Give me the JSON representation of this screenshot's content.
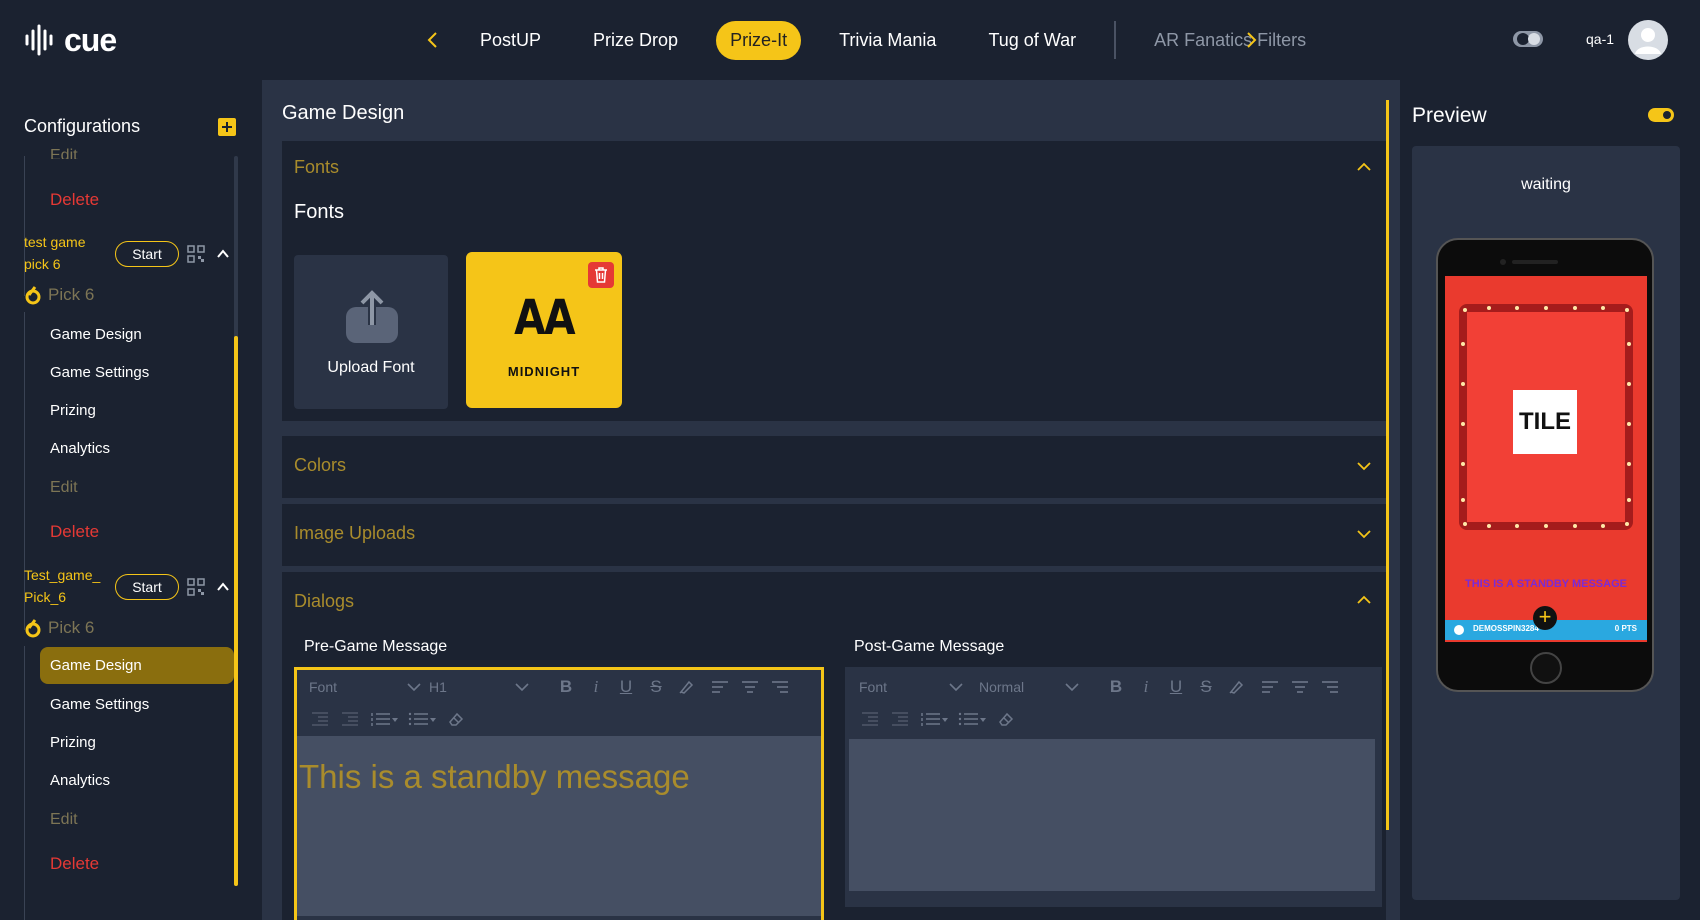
{
  "app": {
    "brand": "cue",
    "user_label": "qa-1"
  },
  "nav": {
    "tabs": [
      {
        "label": "PostUP",
        "state": "normal"
      },
      {
        "label": "Prize Drop",
        "state": "normal"
      },
      {
        "label": "Prize-It",
        "state": "active"
      },
      {
        "label": "Trivia Mania",
        "state": "normal"
      },
      {
        "label": "Tug of War",
        "state": "normal"
      },
      {
        "label": "AR Fanatics Filters",
        "state": "disabled"
      }
    ]
  },
  "sidebar": {
    "title": "Configurations",
    "top_partial_edit": "Edit",
    "top_delete": "Delete",
    "games": [
      {
        "name_line1": "test game",
        "name_line2": "pick 6",
        "start_label": "Start",
        "type_label": "Pick 6",
        "items": [
          "Game Design",
          "Game Settings",
          "Prizing",
          "Analytics"
        ],
        "edit_label": "Edit",
        "delete_label": "Delete"
      },
      {
        "name_line1": "Test_game_",
        "name_line2": "Pick_6",
        "start_label": "Start",
        "type_label": "Pick 6",
        "items": [
          "Game Design",
          "Game Settings",
          "Prizing",
          "Analytics"
        ],
        "active_item": "Game Design",
        "edit_label": "Edit",
        "delete_label": "Delete"
      }
    ]
  },
  "main": {
    "title": "Game Design",
    "fonts_panel": {
      "heading": "Fonts",
      "subheading": "Fonts",
      "upload_label": "Upload Font",
      "font_preview": "AA",
      "font_name": "MIDNIGHT"
    },
    "colors_panel": {
      "heading": "Colors"
    },
    "image_panel": {
      "heading": "Image Uploads"
    },
    "dialogs_panel": {
      "heading": "Dialogs",
      "pre_game": {
        "label": "Pre-Game Message",
        "font_select": "Font",
        "size_select": "H1",
        "content": "This is a standby message"
      },
      "post_game": {
        "label": "Post-Game Message",
        "font_select": "Font",
        "size_select": "Normal",
        "content": ""
      }
    }
  },
  "preview": {
    "title": "Preview",
    "status": "waiting",
    "tile_label": "TILE",
    "standby_text": "THIS IS A STANDBY MESSAGE",
    "strip_left": "DEMOSSPIN3284",
    "strip_right": "0 PTS"
  },
  "colors": {
    "accent": "#f5c518",
    "danger": "#e53935",
    "background": "#1b2230",
    "panel": "#2a3345"
  }
}
